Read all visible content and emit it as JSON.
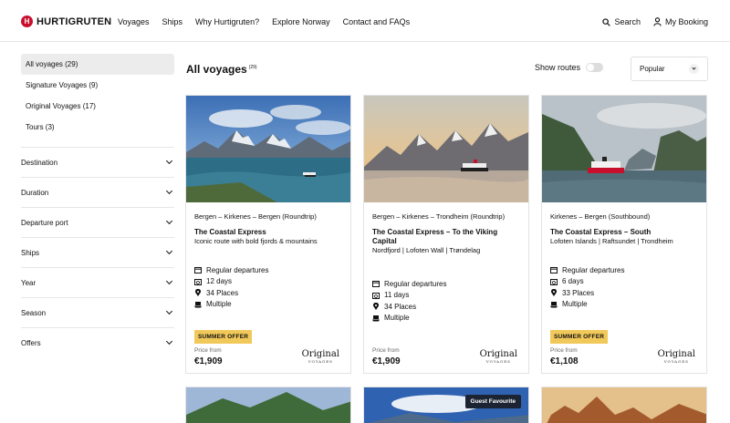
{
  "header": {
    "logo_text": "HURTIGRUTEN",
    "nav": [
      "Voyages",
      "Ships",
      "Why Hurtigruten?",
      "Explore Norway",
      "Contact and FAQs"
    ],
    "search_label": "Search",
    "booking_label": "My Booking"
  },
  "sidebar": {
    "categories": [
      {
        "label": "All voyages (29)",
        "active": true
      },
      {
        "label": "Signature Voyages (9)",
        "active": false
      },
      {
        "label": "Original Voyages (17)",
        "active": false
      },
      {
        "label": "Tours (3)",
        "active": false
      }
    ],
    "filters": [
      "Destination",
      "Duration",
      "Departure port",
      "Ships",
      "Year",
      "Season",
      "Offers"
    ]
  },
  "main": {
    "title": "All voyages",
    "count": "(29)",
    "show_routes_label": "Show routes",
    "sort_value": "Popular"
  },
  "cards": [
    {
      "route": "Bergen – Kirkenes – Bergen (Roundtrip)",
      "ship": "The Coastal Express",
      "subtitle": "Iconic route with bold fjords & mountains",
      "features": [
        "Regular departures",
        "12 days",
        "34 Places",
        "Multiple"
      ],
      "offer": "SUMMER OFFER",
      "price_from": "Price from",
      "price": "€1,909",
      "brand": "Original",
      "brand_sub": "VOYAGES"
    },
    {
      "route": "Bergen – Kirkenes – Trondheim (Roundtrip)",
      "ship": "The Coastal Express – To the Viking Capital",
      "subtitle": "Nordfjord | Lofoten Wall | Trøndelag",
      "features": [
        "Regular departures",
        "11 days",
        "34 Places",
        "Multiple"
      ],
      "offer": "",
      "price_from": "Price from",
      "price": "€1,909",
      "brand": "Original",
      "brand_sub": "VOYAGES"
    },
    {
      "route": "Kirkenes – Bergen (Southbound)",
      "ship": "The Coastal Express – South",
      "subtitle": "Lofoten Islands | Raftsundet | Trondheim",
      "features": [
        "Regular departures",
        "6 days",
        "33 Places",
        "Multiple"
      ],
      "offer": "SUMMER OFFER",
      "price_from": "Price from",
      "price": "€1,108",
      "brand": "Original",
      "brand_sub": "VOYAGES"
    }
  ],
  "next_row": {
    "badge": "Guest Favourite"
  },
  "colors": {
    "brand_red": "#c8102e",
    "offer_yellow": "#f1c95b",
    "badge_navy": "#1c2333"
  }
}
